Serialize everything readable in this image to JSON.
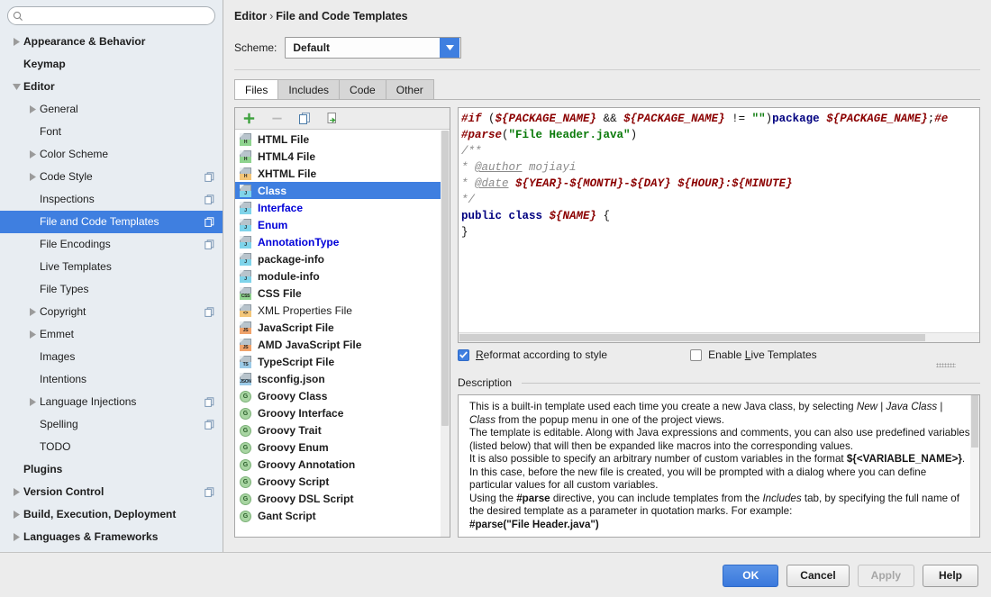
{
  "search": {
    "value": "",
    "placeholder": "",
    "icon": "search-icon"
  },
  "sidebar": {
    "items": [
      {
        "label": "Appearance & Behavior",
        "level": 0,
        "arrow": "right",
        "copy": false,
        "selected": false
      },
      {
        "label": "Keymap",
        "level": 0,
        "arrow": "none",
        "copy": false,
        "selected": false
      },
      {
        "label": "Editor",
        "level": 0,
        "arrow": "down",
        "copy": false,
        "selected": false
      },
      {
        "label": "General",
        "level": 1,
        "arrow": "right",
        "copy": false,
        "selected": false
      },
      {
        "label": "Font",
        "level": 1,
        "arrow": "none",
        "copy": false,
        "selected": false
      },
      {
        "label": "Color Scheme",
        "level": 1,
        "arrow": "right",
        "copy": false,
        "selected": false
      },
      {
        "label": "Code Style",
        "level": 1,
        "arrow": "right",
        "copy": true,
        "selected": false
      },
      {
        "label": "Inspections",
        "level": 1,
        "arrow": "none",
        "copy": true,
        "selected": false
      },
      {
        "label": "File and Code Templates",
        "level": 1,
        "arrow": "none",
        "copy": true,
        "selected": true
      },
      {
        "label": "File Encodings",
        "level": 1,
        "arrow": "none",
        "copy": true,
        "selected": false
      },
      {
        "label": "Live Templates",
        "level": 1,
        "arrow": "none",
        "copy": false,
        "selected": false
      },
      {
        "label": "File Types",
        "level": 1,
        "arrow": "none",
        "copy": false,
        "selected": false
      },
      {
        "label": "Copyright",
        "level": 1,
        "arrow": "right",
        "copy": true,
        "selected": false
      },
      {
        "label": "Emmet",
        "level": 1,
        "arrow": "right",
        "copy": false,
        "selected": false
      },
      {
        "label": "Images",
        "level": 1,
        "arrow": "none",
        "copy": false,
        "selected": false
      },
      {
        "label": "Intentions",
        "level": 1,
        "arrow": "none",
        "copy": false,
        "selected": false
      },
      {
        "label": "Language Injections",
        "level": 1,
        "arrow": "right",
        "copy": true,
        "selected": false
      },
      {
        "label": "Spelling",
        "level": 1,
        "arrow": "none",
        "copy": true,
        "selected": false
      },
      {
        "label": "TODO",
        "level": 1,
        "arrow": "none",
        "copy": false,
        "selected": false
      },
      {
        "label": "Plugins",
        "level": 0,
        "arrow": "none",
        "copy": false,
        "selected": false
      },
      {
        "label": "Version Control",
        "level": 0,
        "arrow": "right",
        "copy": true,
        "selected": false
      },
      {
        "label": "Build, Execution, Deployment",
        "level": 0,
        "arrow": "right",
        "copy": false,
        "selected": false
      },
      {
        "label": "Languages & Frameworks",
        "level": 0,
        "arrow": "right",
        "copy": false,
        "selected": false
      }
    ]
  },
  "header": {
    "breadcrumb_parent": "Editor",
    "breadcrumb_separator": "›",
    "breadcrumb_current": "File and Code Templates",
    "scheme_label": "Scheme:",
    "scheme_value": "Default",
    "scheme_dropdown_icon": "chevron-down-icon"
  },
  "tabs": [
    {
      "label": "Files",
      "active": true
    },
    {
      "label": "Includes",
      "active": false
    },
    {
      "label": "Code",
      "active": false
    },
    {
      "label": "Other",
      "active": false
    }
  ],
  "list_toolbar": [
    {
      "name": "add-template-button",
      "icon": "plus-icon",
      "enabled": true
    },
    {
      "name": "remove-template-button",
      "icon": "minus-icon",
      "enabled": false
    },
    {
      "name": "copy-template-button",
      "icon": "copy-icon",
      "enabled": true
    },
    {
      "name": "reset-to-default-button",
      "icon": "reset-revert-icon",
      "enabled": true
    }
  ],
  "templates": [
    {
      "label": "HTML File",
      "icon": "file-html-icon",
      "badge": "H",
      "badge_color": "#8fd48f",
      "style": "bold",
      "selected": false
    },
    {
      "label": "HTML4 File",
      "icon": "file-html-icon",
      "badge": "H",
      "badge_color": "#8fd48f",
      "style": "bold",
      "selected": false
    },
    {
      "label": "XHTML File",
      "icon": "file-xhtml-icon",
      "badge": "H",
      "badge_color": "#f3c679",
      "style": "bold",
      "selected": false
    },
    {
      "label": "Class",
      "icon": "file-java-icon",
      "badge": "J",
      "badge_color": "#7fd4ea",
      "style": "bold",
      "selected": true
    },
    {
      "label": "Interface",
      "icon": "file-java-icon",
      "badge": "J",
      "badge_color": "#7fd4ea",
      "style": "bold-blue",
      "selected": false
    },
    {
      "label": "Enum",
      "icon": "file-java-icon",
      "badge": "J",
      "badge_color": "#7fd4ea",
      "style": "bold-blue",
      "selected": false
    },
    {
      "label": "AnnotationType",
      "icon": "file-java-icon",
      "badge": "J",
      "badge_color": "#7fd4ea",
      "style": "bold-blue",
      "selected": false
    },
    {
      "label": "package-info",
      "icon": "file-java-icon",
      "badge": "J",
      "badge_color": "#7fd4ea",
      "style": "bold",
      "selected": false
    },
    {
      "label": "module-info",
      "icon": "file-java-icon",
      "badge": "J",
      "badge_color": "#7fd4ea",
      "style": "bold",
      "selected": false
    },
    {
      "label": "CSS File",
      "icon": "file-css-icon",
      "badge": "CSS",
      "badge_color": "#8fd48f",
      "style": "bold",
      "selected": false
    },
    {
      "label": "XML Properties File",
      "icon": "file-xml-icon",
      "badge": "<>",
      "badge_color": "#f3c679",
      "style": "plain",
      "selected": false
    },
    {
      "label": "JavaScript File",
      "icon": "file-js-icon",
      "badge": "JS",
      "badge_color": "#f0a36b",
      "style": "bold",
      "selected": false
    },
    {
      "label": "AMD JavaScript File",
      "icon": "file-js-icon",
      "badge": "JS",
      "badge_color": "#f0a36b",
      "style": "bold",
      "selected": false
    },
    {
      "label": "TypeScript File",
      "icon": "file-ts-icon",
      "badge": "TS",
      "badge_color": "#9ccbe8",
      "style": "bold",
      "selected": false
    },
    {
      "label": "tsconfig.json",
      "icon": "file-json-icon",
      "badge": "JSON",
      "badge_color": "#9ccbe8",
      "style": "bold",
      "selected": false
    },
    {
      "label": "Groovy Class",
      "icon": "groovy-icon",
      "badge": "G",
      "badge_color": "#a8d5a2",
      "style": "bold",
      "selected": false
    },
    {
      "label": "Groovy Interface",
      "icon": "groovy-icon",
      "badge": "G",
      "badge_color": "#a8d5a2",
      "style": "bold",
      "selected": false
    },
    {
      "label": "Groovy Trait",
      "icon": "groovy-icon",
      "badge": "G",
      "badge_color": "#a8d5a2",
      "style": "bold",
      "selected": false
    },
    {
      "label": "Groovy Enum",
      "icon": "groovy-icon",
      "badge": "G",
      "badge_color": "#a8d5a2",
      "style": "bold",
      "selected": false
    },
    {
      "label": "Groovy Annotation",
      "icon": "groovy-icon",
      "badge": "G",
      "badge_color": "#a8d5a2",
      "style": "bold",
      "selected": false
    },
    {
      "label": "Groovy Script",
      "icon": "groovy-icon",
      "badge": "G",
      "badge_color": "#a8d5a2",
      "style": "bold",
      "selected": false
    },
    {
      "label": "Groovy DSL Script",
      "icon": "groovy-icon",
      "badge": "G",
      "badge_color": "#a8d5a2",
      "style": "bold",
      "selected": false
    },
    {
      "label": "Gant Script",
      "icon": "groovy-icon",
      "badge": "G",
      "badge_color": "#a8d5a2",
      "style": "bold",
      "selected": false
    }
  ],
  "editor": {
    "lines": [
      [
        {
          "t": "#if ",
          "c": "dir"
        },
        {
          "t": "(",
          "c": "plain"
        },
        {
          "t": "${PACKAGE_NAME}",
          "c": "var"
        },
        {
          "t": " && ",
          "c": "plain"
        },
        {
          "t": "${PACKAGE_NAME}",
          "c": "var"
        },
        {
          "t": " != ",
          "c": "plain"
        },
        {
          "t": "\"\"",
          "c": "str"
        },
        {
          "t": ")",
          "c": "plain"
        },
        {
          "t": "package",
          "c": "kw"
        },
        {
          "t": " ",
          "c": "plain"
        },
        {
          "t": "${PACKAGE_NAME}",
          "c": "var"
        },
        {
          "t": ";",
          "c": "plain"
        },
        {
          "t": "#e",
          "c": "dir"
        }
      ],
      [
        {
          "t": "#parse",
          "c": "dir"
        },
        {
          "t": "(",
          "c": "plain"
        },
        {
          "t": "\"File Header.java\"",
          "c": "str"
        },
        {
          "t": ")",
          "c": "plain"
        }
      ],
      [
        {
          "t": "/**",
          "c": "cmt"
        }
      ],
      [
        {
          "t": "* ",
          "c": "cmt"
        },
        {
          "t": "@author",
          "c": "tag"
        },
        {
          "t": " mojiayi",
          "c": "cmt"
        }
      ],
      [
        {
          "t": "* ",
          "c": "cmt"
        },
        {
          "t": "@date",
          "c": "tag"
        },
        {
          "t": " ",
          "c": "cmt"
        },
        {
          "t": "${YEAR}",
          "c": "var"
        },
        {
          "t": "-",
          "c": "var"
        },
        {
          "t": "${MONTH}",
          "c": "var"
        },
        {
          "t": "-",
          "c": "var"
        },
        {
          "t": "${DAY}",
          "c": "var"
        },
        {
          "t": " ",
          "c": "plain"
        },
        {
          "t": "${HOUR}",
          "c": "var"
        },
        {
          "t": ":",
          "c": "var"
        },
        {
          "t": "${MINUTE}",
          "c": "var"
        }
      ],
      [
        {
          "t": "*/",
          "c": "cmt"
        }
      ],
      [
        {
          "t": "public class",
          "c": "kw"
        },
        {
          "t": " ",
          "c": "plain"
        },
        {
          "t": "${NAME}",
          "c": "var"
        },
        {
          "t": " {",
          "c": "plain"
        }
      ],
      [
        {
          "t": "}",
          "c": "plain"
        }
      ]
    ]
  },
  "options": {
    "reformat": {
      "label": "Reformat according to style",
      "mnemonic": "R",
      "checked": true
    },
    "live_templates": {
      "label": "Enable Live Templates",
      "mnemonic": "L",
      "checked": false
    }
  },
  "description": {
    "legend": "Description",
    "paragraphs": [
      [
        {
          "t": "This is a built-in template used each time you create a new Java class, by selecting ",
          "s": "n"
        },
        {
          "t": "New",
          "s": "i"
        },
        {
          "t": " | ",
          "s": "n"
        },
        {
          "t": "Java Class",
          "s": "i"
        },
        {
          "t": " | ",
          "s": "n"
        },
        {
          "t": "Class",
          "s": "i"
        },
        {
          "t": " from the popup menu in one of the project views.",
          "s": "n"
        }
      ],
      [
        {
          "t": "The template is editable. Along with Java expressions and comments, you can also use predefined variables (listed below) that will then be expanded like macros into the corresponding values.",
          "s": "n"
        }
      ],
      [
        {
          "t": "It is also possible to specify an arbitrary number of custom variables in the format ",
          "s": "n"
        },
        {
          "t": "${<VARIABLE_NAME>}",
          "s": "b"
        },
        {
          "t": ". In this case, before the new file is created, you will be prompted with a dialog where you can define particular values for all custom variables.",
          "s": "n"
        }
      ],
      [
        {
          "t": "Using the ",
          "s": "n"
        },
        {
          "t": "#parse",
          "s": "b"
        },
        {
          "t": " directive, you can include templates from the ",
          "s": "n"
        },
        {
          "t": "Includes",
          "s": "i"
        },
        {
          "t": " tab, by specifying the full name of the desired template as a parameter in quotation marks. For example:",
          "s": "n"
        }
      ],
      [
        {
          "t": "#parse(\"File Header.java\")",
          "s": "b"
        }
      ]
    ]
  },
  "buttons": [
    {
      "label": "OK",
      "kind": "primary"
    },
    {
      "label": "Cancel",
      "kind": "normal"
    },
    {
      "label": "Apply",
      "kind": "disabled"
    },
    {
      "label": "Help",
      "kind": "normal"
    }
  ],
  "colors": {
    "selection_blue": "#3f7fe0",
    "sidebar_bg": "#e8edf2",
    "panel_bg": "#ececec",
    "link_blue": "#0000d8"
  }
}
